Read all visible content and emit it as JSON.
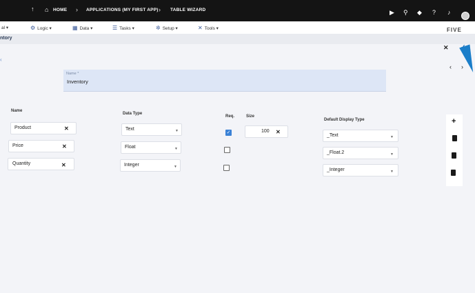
{
  "breadcrumbs": {
    "home": "HOME",
    "application": "APPLICATIONS (MY FIRST APP)",
    "wizard": "TABLE WIZARD"
  },
  "menu": {
    "items": [
      {
        "label": "Logic ▾"
      },
      {
        "label": "Data ▾"
      },
      {
        "label": "Tasks ▾"
      },
      {
        "label": "Setup ▾"
      },
      {
        "label": "Tools ▾"
      }
    ],
    "partial_first": "al ▾",
    "logo": "FIVE"
  },
  "header": {
    "title": "ntory"
  },
  "name_field": {
    "label": "Name *",
    "value": "Inventory"
  },
  "columns": {
    "name": "Name",
    "data_type": "Data Type",
    "req": "Req.",
    "size": "Size",
    "default_display": "Default Display Type"
  },
  "rows": [
    {
      "name": "Product",
      "data_type": "Text",
      "required": true,
      "size": "100",
      "display": "_Text"
    },
    {
      "name": "Price",
      "data_type": "Float",
      "required": false,
      "size": "",
      "display": "_Float.2"
    },
    {
      "name": "Quantity",
      "data_type": "Integer",
      "required": false,
      "size": "",
      "display": "_Integer"
    }
  ],
  "icons": {
    "close": "✕",
    "check": "✓",
    "checked": "✓",
    "prev": "‹",
    "next": "›",
    "plus": "+",
    "caret": "▼",
    "up_arrow": "↑",
    "home": "⌂",
    "chev": "›",
    "side": "‹",
    "play": "▶",
    "search": "⚲",
    "grad": "◆",
    "help": "?",
    "bell": "♪"
  },
  "colors": {
    "accent": "#1b7ec9",
    "topbar": "#141414"
  }
}
